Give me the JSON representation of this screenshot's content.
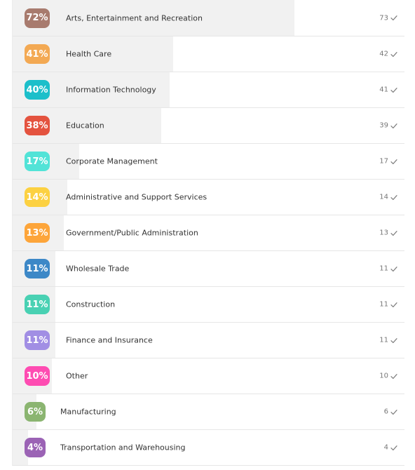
{
  "rows": [
    {
      "pct": "72%",
      "label": "Arts, Entertainment and Recreation",
      "count": "73",
      "color": "#a87b6e",
      "fill": 0.72
    },
    {
      "pct": "41%",
      "label": "Health Care",
      "count": "42",
      "color": "#f3a953",
      "fill": 0.41
    },
    {
      "pct": "40%",
      "label": "Information Technology",
      "count": "41",
      "color": "#1cbfca",
      "fill": 0.4
    },
    {
      "pct": "38%",
      "label": "Education",
      "count": "39",
      "color": "#e4533f",
      "fill": 0.38
    },
    {
      "pct": "17%",
      "label": "Corporate Management",
      "count": "17",
      "color": "#52e3d7",
      "fill": 0.17
    },
    {
      "pct": "14%",
      "label": "Administrative and Support Services",
      "count": "14",
      "color": "#fcd142",
      "fill": 0.14
    },
    {
      "pct": "13%",
      "label": "Government/Public Administration",
      "count": "13",
      "color": "#fda53a",
      "fill": 0.13
    },
    {
      "pct": "11%",
      "label": "Wholesale Trade",
      "count": "11",
      "color": "#3d88c7",
      "fill": 0.11
    },
    {
      "pct": "11%",
      "label": "Construction",
      "count": "11",
      "color": "#49d1b3",
      "fill": 0.11
    },
    {
      "pct": "11%",
      "label": "Finance and Insurance",
      "count": "11",
      "color": "#a18ee4",
      "fill": 0.11
    },
    {
      "pct": "10%",
      "label": "Other",
      "count": "10",
      "color": "#fe4cb2",
      "fill": 0.1
    },
    {
      "pct": "6%",
      "label": "Manufacturing",
      "count": "6",
      "color": "#8bb571",
      "fill": 0.06
    },
    {
      "pct": "4%",
      "label": "Transportation and Warehousing",
      "count": "4",
      "color": "#9b63b5",
      "fill": 0.04
    }
  ],
  "icons": {
    "check": "checkmark-icon"
  }
}
